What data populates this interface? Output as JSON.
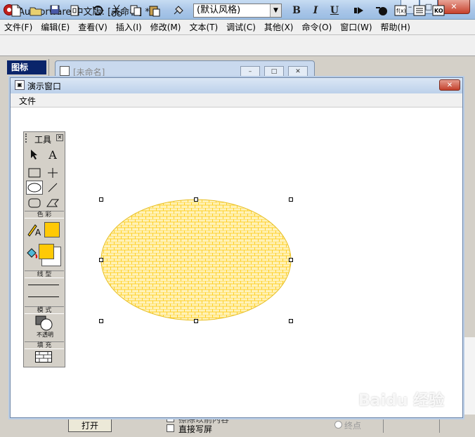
{
  "window": {
    "title": "Authorware 中文版: [未命名] *"
  },
  "caption_buttons": {
    "minimize": "–",
    "maximize": "□",
    "close": "✕"
  },
  "menubar": [
    "文件(F)",
    "编辑(E)",
    "查看(V)",
    "插入(I)",
    "修改(M)",
    "文本(T)",
    "调试(C)",
    "其他(X)",
    "命令(O)",
    "窗口(W)",
    "帮助(H)"
  ],
  "toolbar": {
    "style_select": "(默认风格)",
    "bold": "B",
    "italic": "I",
    "underline": "U"
  },
  "icon_panel": {
    "title": "图标"
  },
  "flow_window": {
    "title": "[未命名]"
  },
  "presentation": {
    "title": "演示窗口",
    "menu_file": "文件",
    "close": "✕"
  },
  "tools": {
    "title": "工具",
    "color_section": "色 彩",
    "line_section": "线 型",
    "mode_section": "模 式",
    "mode_value": "不透明",
    "fill_section": "填 充",
    "text_tool": "A"
  },
  "shape": {
    "type": "ellipse",
    "fill_pattern": "brick",
    "fill_color": "#ffc906",
    "stroke_color": "#e8c02a"
  },
  "colors": {
    "swatch": "#ffc906",
    "titlebar": "#bcd1ea",
    "close": "#c3402b"
  },
  "bottom": {
    "open_button": "打开",
    "checkbox1": "擦除以前内容",
    "checkbox2": "直接写屏",
    "radio_end": "终点"
  },
  "watermark": "Baidu 经验"
}
